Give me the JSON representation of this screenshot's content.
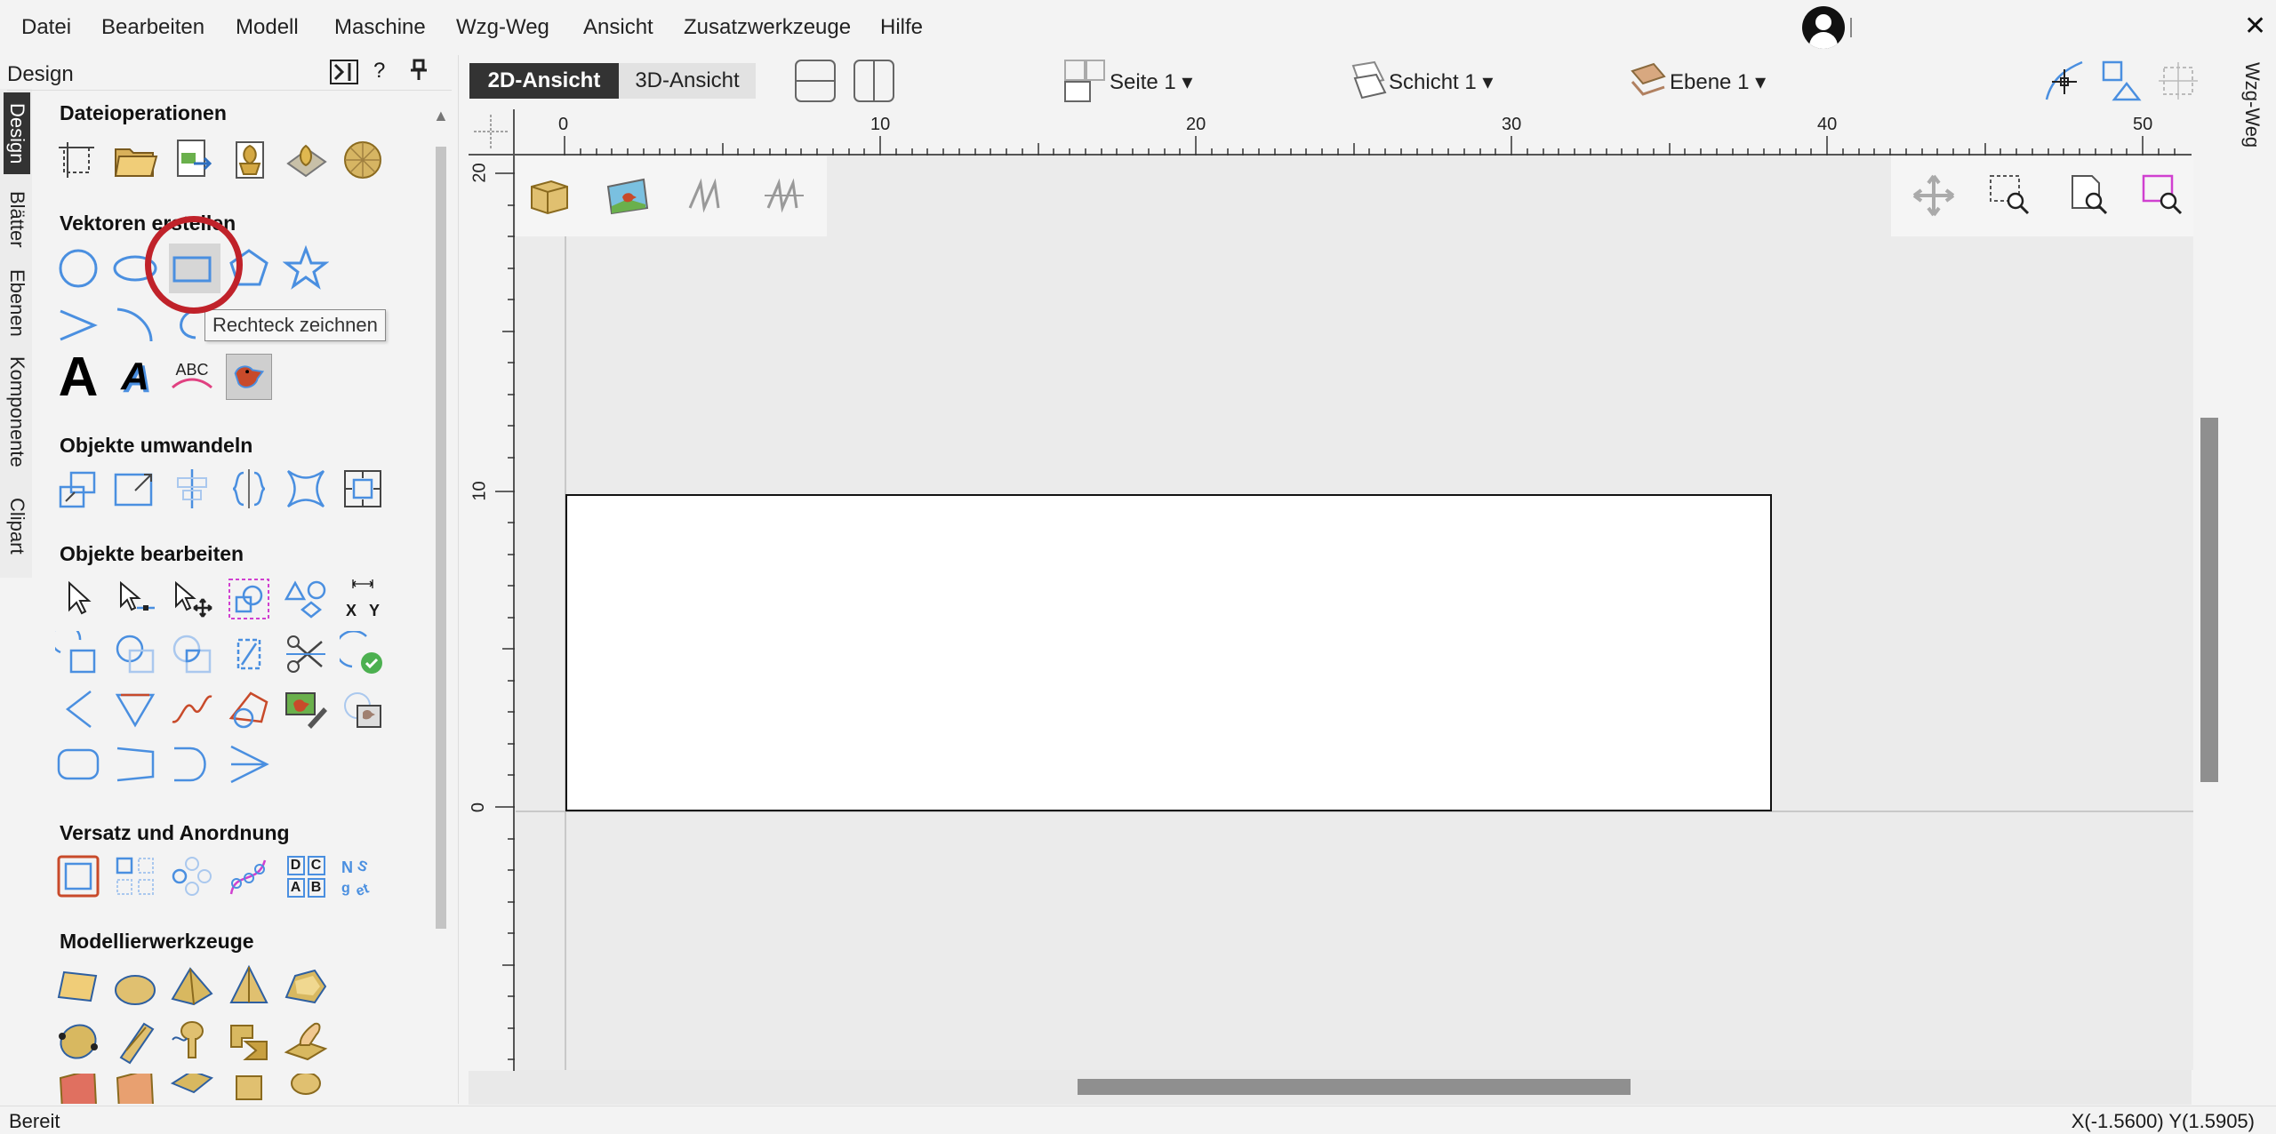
{
  "menu": {
    "items": [
      "Datei",
      "Bearbeiten",
      "Modell",
      "Maschine",
      "Wzg-Weg",
      "Ansicht",
      "Zusatzwerkzeuge",
      "Hilfe"
    ],
    "close_glyph": "✕"
  },
  "side_tabs": [
    "Design",
    "Blätter",
    "Ebenen",
    "Komponente",
    "Clipart"
  ],
  "panel": {
    "title": "Design",
    "help_glyph": "?",
    "pin_glyph": "📌",
    "sections": {
      "file_ops": "Dateioperationen",
      "create_vectors": "Vektoren erstellen",
      "transform": "Objekte umwandeln",
      "edit": "Objekte  bearbeiten",
      "offset": "Versatz und Anordnung",
      "modeling": "Modellierwerkzeuge"
    },
    "tooltip": "Rechteck zeichnen",
    "text_tool_letters": [
      "A",
      "A",
      "ABC"
    ],
    "dim_labels": [
      "X",
      "Y"
    ],
    "nest_labels": [
      "D",
      "C",
      "A",
      "B"
    ]
  },
  "view_toolbar": {
    "tab_2d": "2D-Ansicht",
    "tab_3d": "3D-Ansicht",
    "sheet": "Seite 1 ▾",
    "layer": "Schicht 1 ▾",
    "level": "Ebene 1 ▾"
  },
  "right_tab": "Wzg-Weg",
  "ruler": {
    "top_labels": [
      "0",
      "10",
      "20",
      "30",
      "40",
      "50"
    ],
    "left_labels": [
      "20",
      "10",
      "0"
    ]
  },
  "status": {
    "text": "Bereit",
    "coords": "X(-1.5600) Y(1.5905)"
  },
  "colors": {
    "accent": "#4a8fe0",
    "highlight": "#c0222a",
    "tab_active": "#333333"
  }
}
